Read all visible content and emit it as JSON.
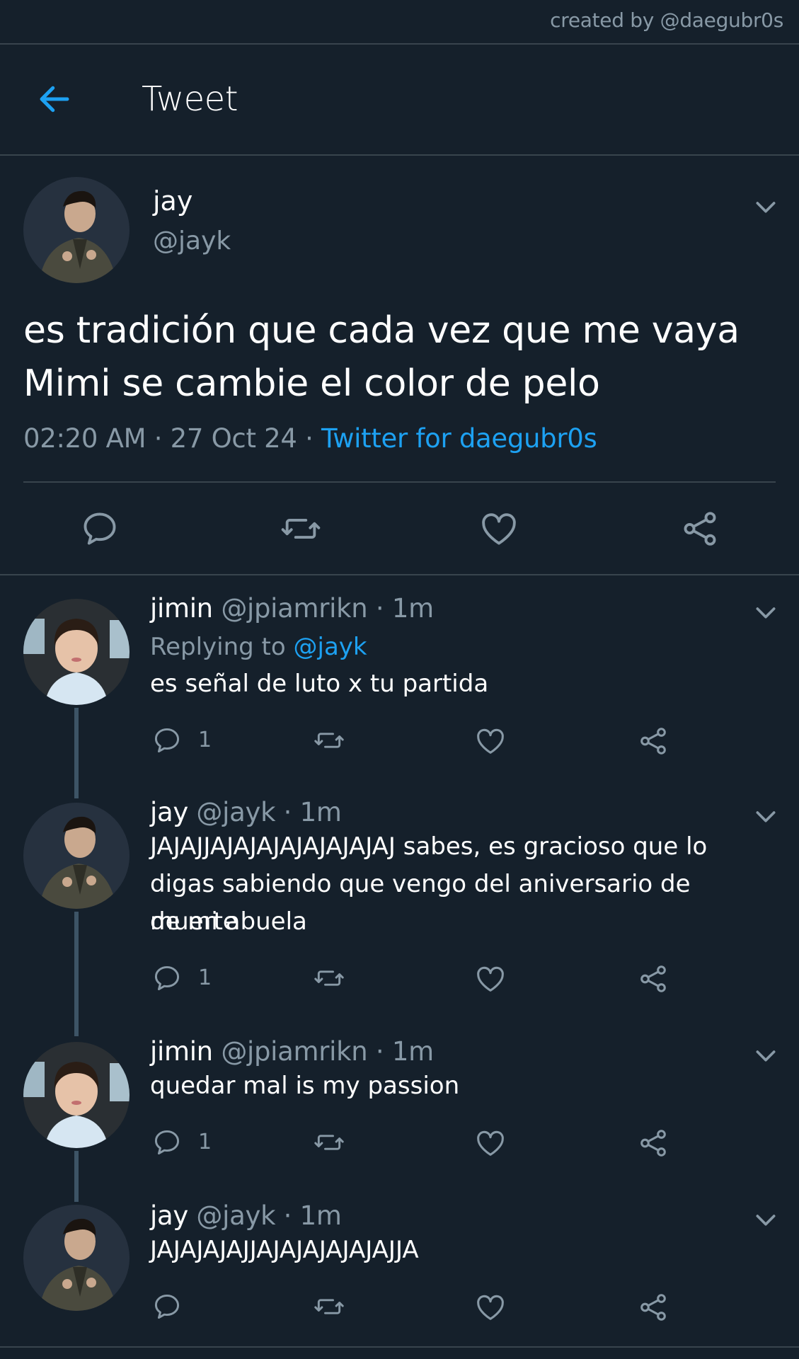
{
  "credit": "created by @daegubr0s",
  "header": {
    "title": "Tweet",
    "back_icon": "back-arrow-icon"
  },
  "colors": {
    "background": "#15202b",
    "accent": "#1da1f2",
    "muted": "#8899a6",
    "divider": "#38444d",
    "thread_line": "#3d5466"
  },
  "main_tweet": {
    "name": "jay",
    "handle": "@jayk",
    "text": "es tradición que cada vez que me vaya Mimi se cambie el color de pelo",
    "time": "02:20 AM",
    "date": "27 Oct 24",
    "separator": "·",
    "source": "Twitter for daegubr0s"
  },
  "replies": [
    {
      "name": "jimin",
      "handle": "@jpiamrikn",
      "dot": "·",
      "time": "1m",
      "replying_prefix": "Replying to",
      "replying_to": "@jayk",
      "text": "es señal de luto x tu partida",
      "reply_count": "1"
    },
    {
      "name": "jay",
      "handle": "@jayk",
      "dot": "·",
      "time": "1m",
      "lines": [
        "JAJAJJAJAJAJAJAJAJAJAJ sabes, es gracioso que lo",
        "digas sabiendo que vengo del aniversario de muerte",
        "de mi abuela"
      ],
      "reply_count": "1"
    },
    {
      "name": "jimin",
      "handle": "@jpiamrikn",
      "dot": "·",
      "time": "1m",
      "text": "quedar mal is my passion",
      "reply_count": "1"
    },
    {
      "name": "jay",
      "handle": "@jayk",
      "dot": "·",
      "time": "1m",
      "text": "JAJAJAJAJJAJAJAJAJAJAJJA",
      "reply_count": ""
    }
  ]
}
